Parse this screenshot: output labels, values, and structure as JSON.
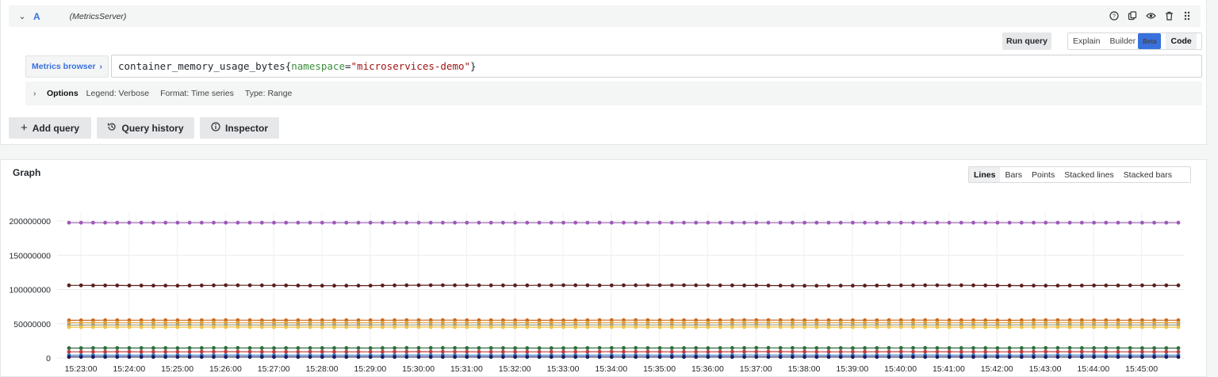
{
  "query": {
    "letter": "A",
    "datasource": "(MetricsServer)",
    "run_label": "Run query",
    "modes": [
      {
        "label": "Explain",
        "active": false
      },
      {
        "label": "Builder",
        "active": false,
        "badge": "Beta"
      },
      {
        "label": "Code",
        "active": true
      }
    ],
    "metrics_browser_label": "Metrics browser",
    "expression": {
      "metric": "container_memory_usage_bytes",
      "label_key": "namespace",
      "label_value": "\"microservices-demo\""
    },
    "options": {
      "title": "Options",
      "legend": "Legend: Verbose",
      "format": "Format: Time series",
      "type": "Type: Range"
    },
    "buttons": {
      "add": "Add query",
      "history": "Query history",
      "inspector": "Inspector"
    }
  },
  "graph": {
    "title": "Graph",
    "modes": [
      "Lines",
      "Bars",
      "Points",
      "Stacked lines",
      "Stacked bars"
    ],
    "active_mode": "Lines"
  },
  "chart_data": {
    "type": "line",
    "x": [
      "15:23:00",
      "15:24:00",
      "15:25:00",
      "15:26:00",
      "15:27:00",
      "15:28:00",
      "15:29:00",
      "15:30:00",
      "15:31:00",
      "15:32:00",
      "15:33:00",
      "15:34:00",
      "15:35:00",
      "15:36:00",
      "15:37:00",
      "15:38:00",
      "15:39:00",
      "15:40:00",
      "15:41:00",
      "15:42:00",
      "15:43:00",
      "15:44:00",
      "15:45:00"
    ],
    "yticks": [
      0,
      50000000,
      100000000,
      150000000,
      200000000
    ],
    "ylim": [
      0,
      200000000
    ],
    "series": [
      {
        "color": "#9b59b6",
        "values": [
          197500000,
          197500000,
          197500000,
          197500000,
          197500000,
          197500000,
          197500000,
          197500000,
          197500000,
          197500000,
          197500000,
          197500000,
          197500000,
          197500000,
          197500000,
          197500000,
          197500000,
          197500000,
          197500000,
          197500000,
          197500000,
          197500000,
          197500000
        ]
      },
      {
        "color": "#5a1e1e",
        "values": [
          106000000,
          105800000,
          105600000,
          106200000,
          106000000,
          105500000,
          105700000,
          106300000,
          106100000,
          106000000,
          106200000,
          106000000,
          106300000,
          106100000,
          105900000,
          105400000,
          105600000,
          106000000,
          106200000,
          105800000,
          105600000,
          105900000,
          106000000
        ]
      },
      {
        "color": "#c8671f",
        "values": [
          55000000,
          55200000,
          55100000,
          55300000,
          55000000,
          55200000,
          55100000,
          55300000,
          55200000,
          55100000,
          55000000,
          55300000,
          55200000,
          55100000,
          55400000,
          55200000,
          55100000,
          55300000,
          55200000,
          55000000,
          55300000,
          55200000,
          55100000
        ]
      },
      {
        "color": "#e0a33a",
        "values": [
          51500000,
          51700000,
          51600000,
          51800000,
          51500000,
          51700000,
          51600000,
          51800000,
          51700000,
          51600000,
          51500000,
          51800000,
          51700000,
          51600000,
          51900000,
          51700000,
          51600000,
          51800000,
          51700000,
          51500000,
          51800000,
          51700000,
          51600000
        ]
      },
      {
        "color": "#a89f7e",
        "values": [
          48000000,
          48200000,
          48100000,
          48300000,
          48000000,
          48200000,
          48100000,
          48300000,
          48200000,
          48100000,
          48000000,
          48300000,
          48200000,
          48100000,
          48400000,
          48200000,
          48100000,
          48300000,
          48200000,
          48000000,
          48300000,
          48200000,
          48100000
        ]
      },
      {
        "color": "#f0c246",
        "values": [
          45000000,
          45100000,
          45000000,
          45200000,
          45000000,
          45100000,
          45000000,
          45200000,
          45100000,
          45000000,
          45000000,
          45200000,
          45100000,
          45000000,
          45300000,
          45100000,
          45000000,
          45200000,
          45100000,
          45000000,
          45200000,
          45100000,
          45000000
        ]
      },
      {
        "color": "#2f6b3f",
        "values": [
          14500000,
          14600000,
          14500000,
          14700000,
          14500000,
          14600000,
          14500000,
          14700000,
          14600000,
          14500000,
          14500000,
          14700000,
          14600000,
          14500000,
          14800000,
          14600000,
          14500000,
          14700000,
          14600000,
          14500000,
          14700000,
          14600000,
          14500000
        ]
      },
      {
        "color": "#c23b3b",
        "values": [
          9000000,
          9100000,
          9000000,
          9200000,
          9000000,
          9100000,
          9000000,
          9200000,
          9100000,
          9000000,
          9000000,
          9200000,
          9100000,
          9000000,
          9300000,
          9100000,
          9000000,
          9200000,
          9100000,
          9000000,
          9200000,
          9100000,
          9000000
        ]
      },
      {
        "color": "#3b78c2",
        "values": [
          4000000,
          4100000,
          4000000,
          4200000,
          4000000,
          4100000,
          4000000,
          4200000,
          4100000,
          4000000,
          4000000,
          4200000,
          4100000,
          4000000,
          4300000,
          4100000,
          4000000,
          4200000,
          4100000,
          4000000,
          4200000,
          4100000,
          4000000
        ]
      },
      {
        "color": "#1a1a5e",
        "values": [
          1500000,
          1500000,
          1500000,
          1500000,
          1500000,
          1500000,
          1500000,
          1500000,
          1500000,
          1500000,
          1500000,
          1500000,
          1500000,
          1500000,
          1500000,
          1500000,
          1500000,
          1500000,
          1500000,
          1500000,
          1500000,
          1500000,
          1500000
        ]
      }
    ]
  }
}
